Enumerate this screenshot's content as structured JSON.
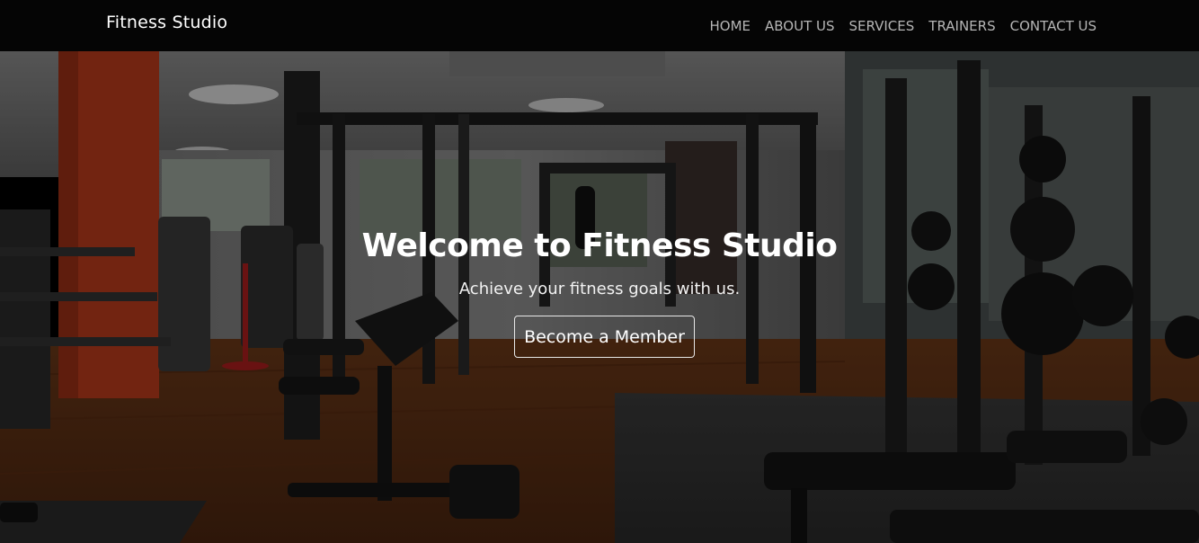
{
  "brand": "Fitness Studio",
  "nav": {
    "items": [
      {
        "label": "HOME"
      },
      {
        "label": "ABOUT US"
      },
      {
        "label": "SERVICES"
      },
      {
        "label": "TRAINERS"
      },
      {
        "label": "CONTACT US"
      }
    ]
  },
  "hero": {
    "title": "Welcome to Fitness Studio",
    "subtitle": "Achieve your fitness goals with us.",
    "cta_label": "Become a Member"
  },
  "colors": {
    "nav_bg": "#050505",
    "nav_text": "#b5b5b5",
    "accent_pillar": "#b93a1c",
    "floor_wood": "#5a2f17"
  }
}
